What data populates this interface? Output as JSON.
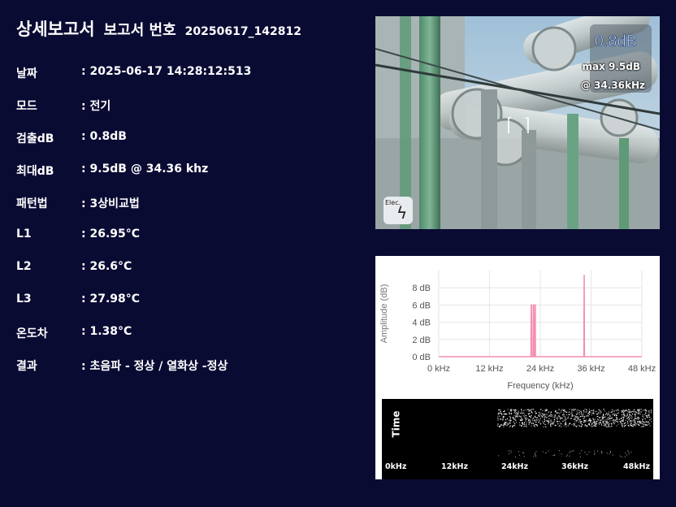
{
  "header": {
    "title": "상세보고서",
    "subtitle": "보고서 번호",
    "report_number": "20250617_142812"
  },
  "details": [
    {
      "label": "날짜",
      "value": ": 2025-06-17 14:28:12:513"
    },
    {
      "label": "모드",
      "value": ": 전기"
    },
    {
      "label": "검출dB",
      "value": ": 0.8dB"
    },
    {
      "label": "최대dB",
      "value": ": 9.5dB @ 34.36 khz"
    },
    {
      "label": "패턴법",
      "value": ": 3상비교법"
    },
    {
      "label": "L1",
      "value": ": 26.95°C"
    },
    {
      "label": "L2",
      "value": ": 26.6°C"
    },
    {
      "label": "L3",
      "value": ": 27.98°C"
    },
    {
      "label": "온도차",
      "value": ": 1.38°C"
    },
    {
      "label": "결과",
      "value": ": 초음파 - 정상 / 열화상 -정상"
    }
  ],
  "camera": {
    "detected_db": "0.8dB",
    "max_line": "max 9.5dB",
    "freq_line": "@ 34.36kHz",
    "mode_badge": "Elec.",
    "mode_icon": "lightning-bolt-icon",
    "crosshair": "⌈ ⌉"
  },
  "chart_data": {
    "type": "line",
    "x_unit": "kHz",
    "xlabel": "Frequency (kHz)",
    "ylabel": "Amplitude (dB)",
    "xlim": [
      0,
      48
    ],
    "ylim": [
      0,
      10
    ],
    "x_ticks": [
      "0 kHz",
      "12 kHz",
      "24 kHz",
      "36 kHz",
      "48 kHz"
    ],
    "y_ticks": [
      "0 dB",
      "2 dB",
      "4 dB",
      "6 dB",
      "8 dB"
    ],
    "grid": true,
    "line_color": "#f48fb1",
    "x": [
      0,
      21.8,
      21.85,
      21.9,
      21.95,
      22.3,
      22.35,
      22.4,
      22.45,
      22.7,
      22.75,
      22.8,
      22.85,
      34.3,
      34.36,
      34.42,
      48
    ],
    "y": [
      0,
      0,
      6,
      6,
      0,
      0,
      6,
      6,
      0,
      0,
      6,
      6,
      0,
      0,
      9.5,
      0,
      0
    ]
  },
  "spectrogram": {
    "y_label": "Time",
    "x_ticks": [
      "0kHz",
      "12kHz",
      "24kHz",
      "36kHz",
      "48kHz"
    ]
  },
  "colors": {
    "background": "#0a0b33",
    "text": "#ffffff",
    "line": "#f48fb1"
  }
}
